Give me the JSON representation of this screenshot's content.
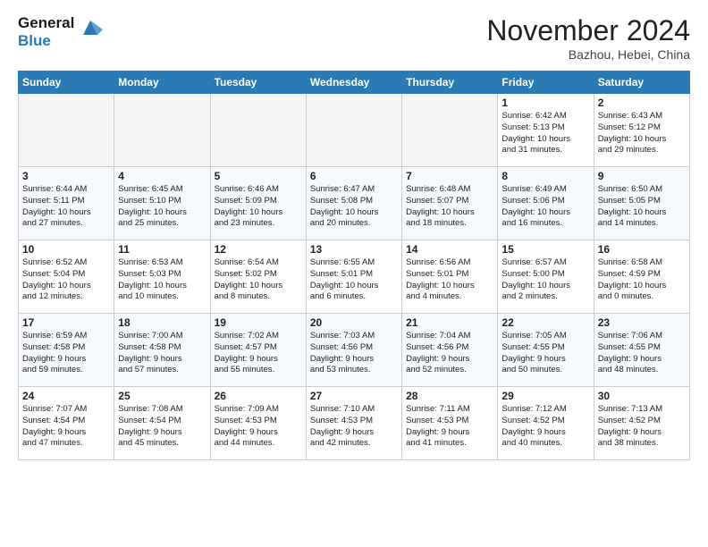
{
  "header": {
    "logo_line1": "General",
    "logo_line2": "Blue",
    "month_title": "November 2024",
    "location": "Bazhou, Hebei, China"
  },
  "weekdays": [
    "Sunday",
    "Monday",
    "Tuesday",
    "Wednesday",
    "Thursday",
    "Friday",
    "Saturday"
  ],
  "weeks": [
    [
      {
        "day": "",
        "info": ""
      },
      {
        "day": "",
        "info": ""
      },
      {
        "day": "",
        "info": ""
      },
      {
        "day": "",
        "info": ""
      },
      {
        "day": "",
        "info": ""
      },
      {
        "day": "1",
        "info": "Sunrise: 6:42 AM\nSunset: 5:13 PM\nDaylight: 10 hours\nand 31 minutes."
      },
      {
        "day": "2",
        "info": "Sunrise: 6:43 AM\nSunset: 5:12 PM\nDaylight: 10 hours\nand 29 minutes."
      }
    ],
    [
      {
        "day": "3",
        "info": "Sunrise: 6:44 AM\nSunset: 5:11 PM\nDaylight: 10 hours\nand 27 minutes."
      },
      {
        "day": "4",
        "info": "Sunrise: 6:45 AM\nSunset: 5:10 PM\nDaylight: 10 hours\nand 25 minutes."
      },
      {
        "day": "5",
        "info": "Sunrise: 6:46 AM\nSunset: 5:09 PM\nDaylight: 10 hours\nand 23 minutes."
      },
      {
        "day": "6",
        "info": "Sunrise: 6:47 AM\nSunset: 5:08 PM\nDaylight: 10 hours\nand 20 minutes."
      },
      {
        "day": "7",
        "info": "Sunrise: 6:48 AM\nSunset: 5:07 PM\nDaylight: 10 hours\nand 18 minutes."
      },
      {
        "day": "8",
        "info": "Sunrise: 6:49 AM\nSunset: 5:06 PM\nDaylight: 10 hours\nand 16 minutes."
      },
      {
        "day": "9",
        "info": "Sunrise: 6:50 AM\nSunset: 5:05 PM\nDaylight: 10 hours\nand 14 minutes."
      }
    ],
    [
      {
        "day": "10",
        "info": "Sunrise: 6:52 AM\nSunset: 5:04 PM\nDaylight: 10 hours\nand 12 minutes."
      },
      {
        "day": "11",
        "info": "Sunrise: 6:53 AM\nSunset: 5:03 PM\nDaylight: 10 hours\nand 10 minutes."
      },
      {
        "day": "12",
        "info": "Sunrise: 6:54 AM\nSunset: 5:02 PM\nDaylight: 10 hours\nand 8 minutes."
      },
      {
        "day": "13",
        "info": "Sunrise: 6:55 AM\nSunset: 5:01 PM\nDaylight: 10 hours\nand 6 minutes."
      },
      {
        "day": "14",
        "info": "Sunrise: 6:56 AM\nSunset: 5:01 PM\nDaylight: 10 hours\nand 4 minutes."
      },
      {
        "day": "15",
        "info": "Sunrise: 6:57 AM\nSunset: 5:00 PM\nDaylight: 10 hours\nand 2 minutes."
      },
      {
        "day": "16",
        "info": "Sunrise: 6:58 AM\nSunset: 4:59 PM\nDaylight: 10 hours\nand 0 minutes."
      }
    ],
    [
      {
        "day": "17",
        "info": "Sunrise: 6:59 AM\nSunset: 4:58 PM\nDaylight: 9 hours\nand 59 minutes."
      },
      {
        "day": "18",
        "info": "Sunrise: 7:00 AM\nSunset: 4:58 PM\nDaylight: 9 hours\nand 57 minutes."
      },
      {
        "day": "19",
        "info": "Sunrise: 7:02 AM\nSunset: 4:57 PM\nDaylight: 9 hours\nand 55 minutes."
      },
      {
        "day": "20",
        "info": "Sunrise: 7:03 AM\nSunset: 4:56 PM\nDaylight: 9 hours\nand 53 minutes."
      },
      {
        "day": "21",
        "info": "Sunrise: 7:04 AM\nSunset: 4:56 PM\nDaylight: 9 hours\nand 52 minutes."
      },
      {
        "day": "22",
        "info": "Sunrise: 7:05 AM\nSunset: 4:55 PM\nDaylight: 9 hours\nand 50 minutes."
      },
      {
        "day": "23",
        "info": "Sunrise: 7:06 AM\nSunset: 4:55 PM\nDaylight: 9 hours\nand 48 minutes."
      }
    ],
    [
      {
        "day": "24",
        "info": "Sunrise: 7:07 AM\nSunset: 4:54 PM\nDaylight: 9 hours\nand 47 minutes."
      },
      {
        "day": "25",
        "info": "Sunrise: 7:08 AM\nSunset: 4:54 PM\nDaylight: 9 hours\nand 45 minutes."
      },
      {
        "day": "26",
        "info": "Sunrise: 7:09 AM\nSunset: 4:53 PM\nDaylight: 9 hours\nand 44 minutes."
      },
      {
        "day": "27",
        "info": "Sunrise: 7:10 AM\nSunset: 4:53 PM\nDaylight: 9 hours\nand 42 minutes."
      },
      {
        "day": "28",
        "info": "Sunrise: 7:11 AM\nSunset: 4:53 PM\nDaylight: 9 hours\nand 41 minutes."
      },
      {
        "day": "29",
        "info": "Sunrise: 7:12 AM\nSunset: 4:52 PM\nDaylight: 9 hours\nand 40 minutes."
      },
      {
        "day": "30",
        "info": "Sunrise: 7:13 AM\nSunset: 4:52 PM\nDaylight: 9 hours\nand 38 minutes."
      }
    ]
  ]
}
